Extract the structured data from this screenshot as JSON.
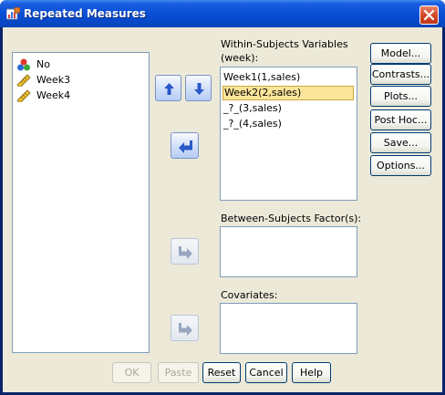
{
  "window": {
    "title": "Repeated Measures",
    "icon": "spss-dialog-icon",
    "close_icon": "close-icon"
  },
  "source_list": {
    "items": [
      {
        "label": "No",
        "icon": "nominal-variable-icon"
      },
      {
        "label": "Week3",
        "icon": "scale-variable-icon"
      },
      {
        "label": "Week4",
        "icon": "scale-variable-icon"
      }
    ]
  },
  "within_subjects": {
    "label": "Within-Subjects Variables",
    "factor": "(week):",
    "items": [
      {
        "label": "Week1(1,sales)",
        "selected": false
      },
      {
        "label": "Week2(2,sales)",
        "selected": true
      },
      {
        "label": "_?_(3,sales)",
        "selected": false
      },
      {
        "label": "_?_(4,sales)",
        "selected": false
      }
    ]
  },
  "between_subjects": {
    "label": "Between-Subjects Factor(s):",
    "items": []
  },
  "covariates": {
    "label": "Covariates:",
    "items": []
  },
  "side_buttons": [
    "Model...",
    "Contrasts...",
    "Plots...",
    "Post Hoc...",
    "Save...",
    "Options..."
  ],
  "bottom_buttons": {
    "ok": "OK",
    "paste": "Paste",
    "reset": "Reset",
    "cancel": "Cancel",
    "help": "Help"
  },
  "colors": {
    "titlebar": "#0a50d8",
    "dialog_bg": "#ece9d8",
    "selection": "#fbe59a",
    "list_border": "#7f9db9"
  }
}
